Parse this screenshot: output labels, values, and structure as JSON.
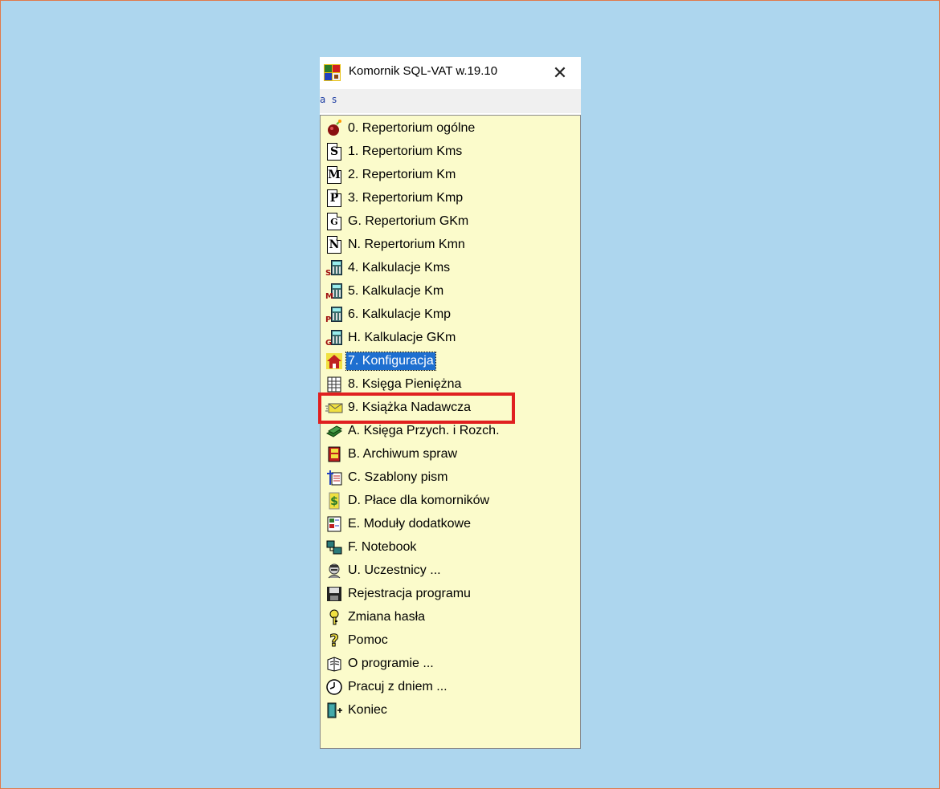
{
  "window": {
    "title": "Komornik SQL-VAT w.19.10",
    "close_glyph": "✕",
    "menubar_text": "a s"
  },
  "menu": {
    "items": [
      {
        "label": "0.  Repertorium ogólne",
        "icon": "bomb-icon"
      },
      {
        "label": "1.  Repertorium Kms",
        "icon": "letter-s-doc-icon",
        "glyph": "S"
      },
      {
        "label": "2.  Repertorium Km",
        "icon": "letter-m-doc-icon",
        "glyph": "M"
      },
      {
        "label": "3.  Repertorium Kmp",
        "icon": "letter-p-doc-icon",
        "glyph": "P"
      },
      {
        "label": "G.  Repertorium GKm",
        "icon": "letter-g-doc-icon",
        "glyph": "G"
      },
      {
        "label": "N.  Repertorium Kmn",
        "icon": "letter-n-doc-icon",
        "glyph": "N"
      },
      {
        "label": "4.  Kalkulacje Kms",
        "icon": "calculator-s-icon",
        "glyph": "S"
      },
      {
        "label": "5.  Kalkulacje Km",
        "icon": "calculator-m-icon",
        "glyph": "M"
      },
      {
        "label": "6.  Kalkulacje Kmp",
        "icon": "calculator-p-icon",
        "glyph": "P"
      },
      {
        "label": "H.  Kalkulacje GKm",
        "icon": "calculator-g-icon",
        "glyph": "G"
      },
      {
        "label": "7.  Konfiguracja",
        "icon": "house-icon",
        "selected": true
      },
      {
        "label": "8.  Księga Pieniężna",
        "icon": "ledger-icon"
      },
      {
        "label": "9.  Książka Nadawcza",
        "icon": "envelope-icon",
        "highlighted": true
      },
      {
        "label": "A.  Księga Przych. i Rozch.",
        "icon": "money-icon"
      },
      {
        "label": "B.  Archiwum spraw",
        "icon": "archive-icon"
      },
      {
        "label": "C.  Szablony pism",
        "icon": "templates-icon"
      },
      {
        "label": "D.  Płace dla komorników",
        "icon": "dollar-icon"
      },
      {
        "label": "E.  Moduły dodatkowe",
        "icon": "modules-icon"
      },
      {
        "label": "F.  Notebook",
        "icon": "notebook-icon"
      },
      {
        "label": "U. Uczestnicy ...",
        "icon": "participants-icon"
      },
      {
        "label": "Rejestracja programu",
        "icon": "floppy-icon"
      },
      {
        "label": "Zmiana hasła",
        "icon": "key-icon"
      },
      {
        "label": "Pomoc",
        "icon": "help-icon"
      },
      {
        "label": "O programie ...",
        "icon": "about-icon"
      },
      {
        "label": "Pracuj z dniem ...",
        "icon": "clock-icon"
      },
      {
        "label": "Koniec",
        "icon": "exit-door-icon"
      }
    ]
  },
  "colors": {
    "desktop": "#add6ee",
    "menu_background": "#fbfbcb",
    "selection": "#1e6fd0",
    "highlight_box": "#e02020"
  }
}
